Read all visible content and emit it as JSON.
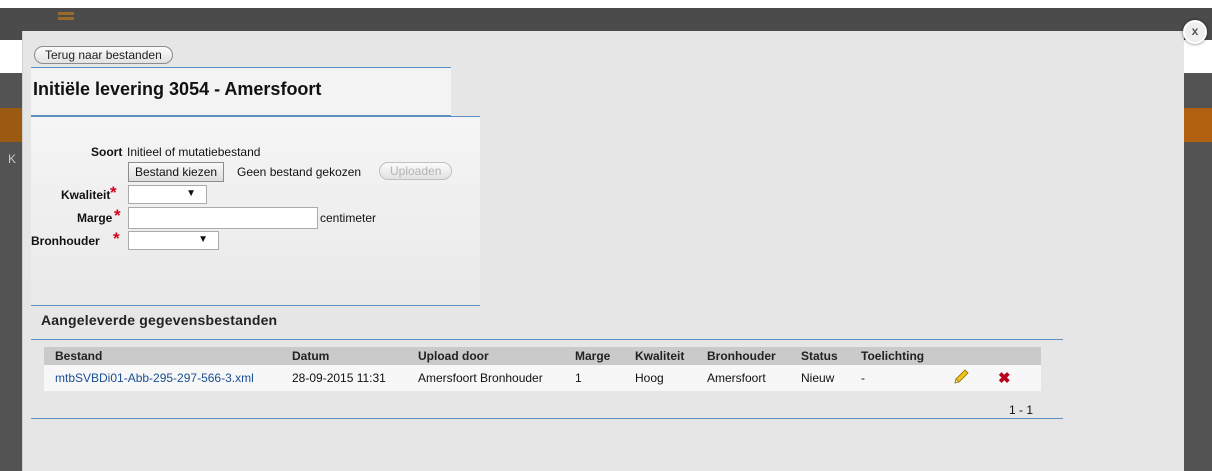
{
  "modal": {
    "back_button": "Terug naar bestanden",
    "title": "Initiële levering 3054 - Amersfoort",
    "close_label": "x"
  },
  "background_page": {
    "left_letter": "K",
    "colors": {
      "header": "#4b4b4b",
      "orange_band": "#b06010"
    }
  },
  "form": {
    "soort_label": "Soort",
    "soort_value": "Initieel of mutatiebestand",
    "choose_file_button": "Bestand kiezen",
    "no_file_text": "Geen bestand gekozen",
    "upload_button": "Uploaden",
    "kwaliteit_label": "Kwaliteit",
    "marge_label": "Marge",
    "marge_unit": "centimeter",
    "marge_value": "",
    "bronhouder_label": "Bronhouder",
    "required_mark": "*",
    "kwaliteit_selected": "",
    "bronhouder_selected": ""
  },
  "files": {
    "title": "Aangeleverde gegevensbestanden",
    "columns": [
      "Bestand",
      "Datum",
      "Upload door",
      "Marge",
      "Kwaliteit",
      "Bronhouder",
      "Status",
      "Toelichting"
    ],
    "rows": [
      {
        "bestand": "mtbSVBDi01-Abb-295-297-566-3.xml",
        "datum": "28-09-2015 11:31",
        "upload_door": "Amersfoort Bronhouder",
        "marge": "1",
        "kwaliteit": "Hoog",
        "bronhouder": "Amersfoort",
        "status": "Nieuw",
        "toelichting": "-"
      }
    ],
    "pager": "1 - 1",
    "icons": {
      "edit": "pencil-icon",
      "delete": "delete-x-icon"
    }
  }
}
